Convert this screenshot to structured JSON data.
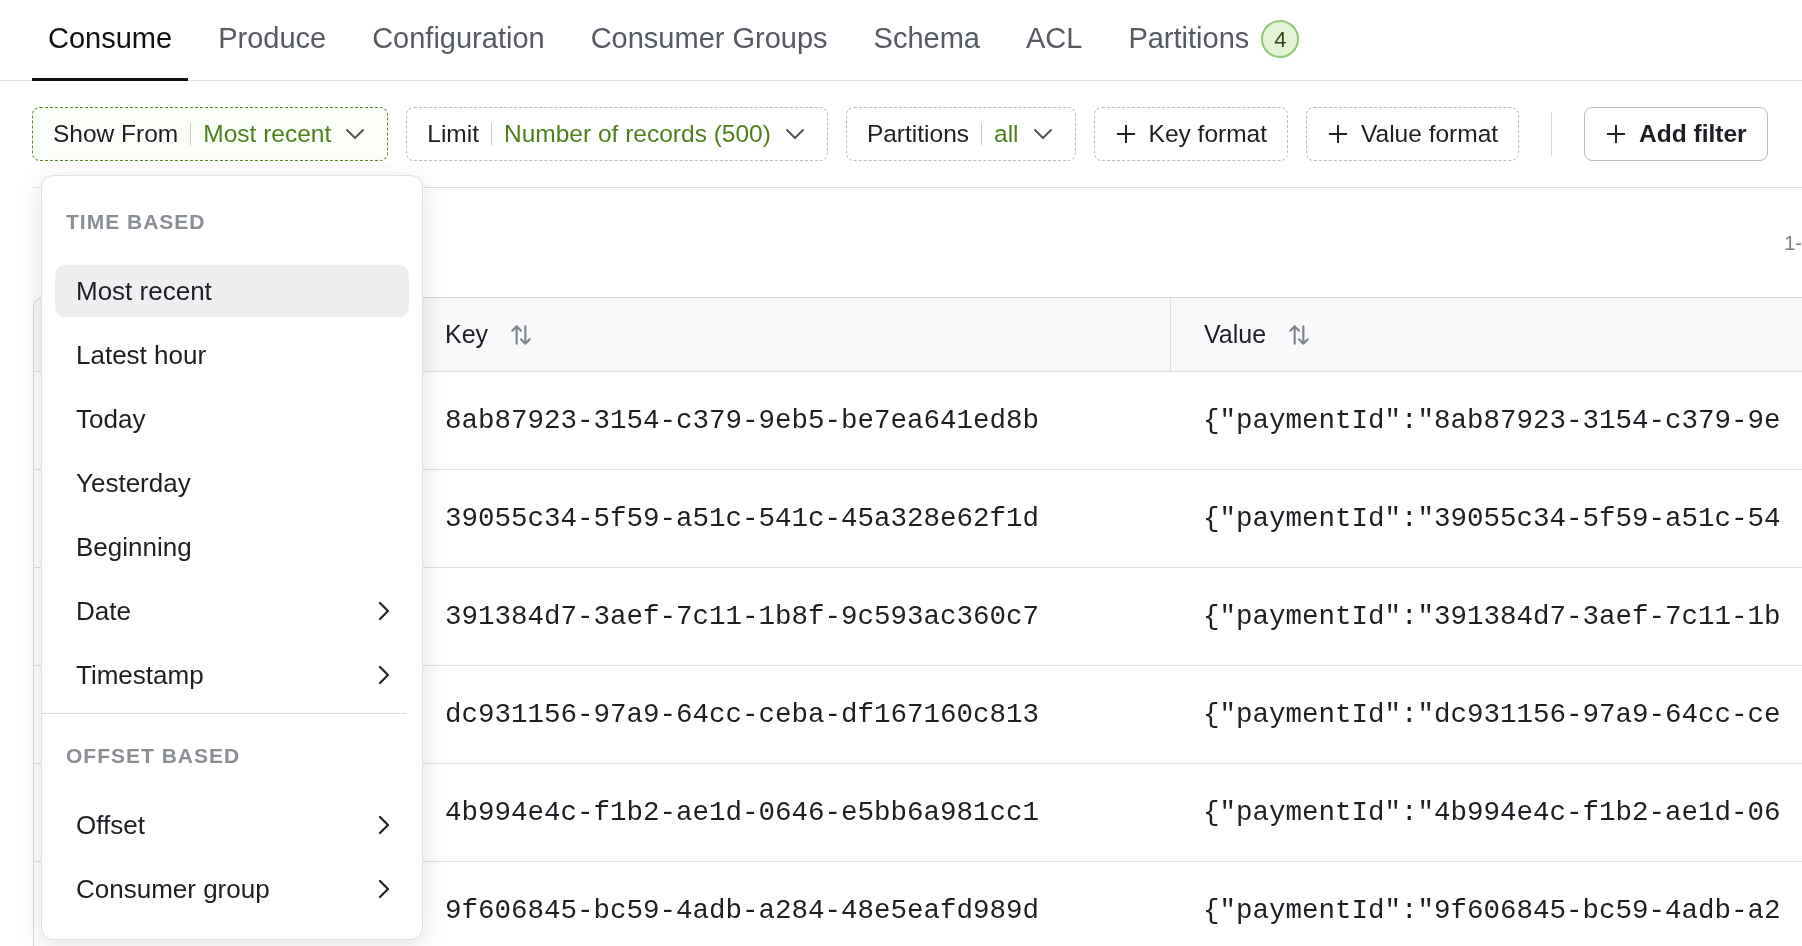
{
  "tabs": [
    {
      "label": "Consume",
      "selected": true
    },
    {
      "label": "Produce",
      "selected": false
    },
    {
      "label": "Configuration",
      "selected": false
    },
    {
      "label": "Consumer Groups",
      "selected": false
    },
    {
      "label": "Schema",
      "selected": false
    },
    {
      "label": "ACL",
      "selected": false
    },
    {
      "label": "Partitions",
      "selected": false,
      "badge": "4"
    }
  ],
  "toolbar": {
    "filters": [
      {
        "kind": "select",
        "label": "Show From",
        "value": "Most recent",
        "open": true
      },
      {
        "kind": "select",
        "label": "Limit",
        "value": "Number of records (500)",
        "open": false
      },
      {
        "kind": "select",
        "label": "Partitions",
        "value": "all",
        "open": false
      },
      {
        "kind": "format",
        "label": "Key format"
      },
      {
        "kind": "format",
        "label": "Value format"
      }
    ],
    "add_filter": "Add filter"
  },
  "pagination": "1-",
  "table": {
    "columns": [
      {
        "label": "Key",
        "sortable": true
      },
      {
        "label": "Value",
        "sortable": true
      }
    ],
    "rows": [
      {
        "key": "8ab87923-3154-c379-9eb5-be7ea641ed8b",
        "value": "{\"paymentId\":\"8ab87923-3154-c379-9e"
      },
      {
        "key": "39055c34-5f59-a51c-541c-45a328e62f1d",
        "value": "{\"paymentId\":\"39055c34-5f59-a51c-54"
      },
      {
        "key": "391384d7-3aef-7c11-1b8f-9c593ac360c7",
        "value": "{\"paymentId\":\"391384d7-3aef-7c11-1b"
      },
      {
        "key": "dc931156-97a9-64cc-ceba-df167160c813",
        "value": "{\"paymentId\":\"dc931156-97a9-64cc-ce"
      },
      {
        "key": "4b994e4c-f1b2-ae1d-0646-e5bb6a981cc1",
        "value": "{\"paymentId\":\"4b994e4c-f1b2-ae1d-06"
      },
      {
        "key": "9f606845-bc59-4adb-a284-48e5eafd989d",
        "value": "{\"paymentId\":\"9f606845-bc59-4adb-a2"
      }
    ]
  },
  "dropdown": {
    "sections": [
      {
        "title": "TIME BASED",
        "items": [
          {
            "label": "Most recent",
            "selected": true,
            "submenu": false
          },
          {
            "label": "Latest hour",
            "selected": false,
            "submenu": false
          },
          {
            "label": "Today",
            "selected": false,
            "submenu": false
          },
          {
            "label": "Yesterday",
            "selected": false,
            "submenu": false
          },
          {
            "label": "Beginning",
            "selected": false,
            "submenu": false
          },
          {
            "label": "Date",
            "selected": false,
            "submenu": true
          },
          {
            "label": "Timestamp",
            "selected": false,
            "submenu": true
          }
        ]
      },
      {
        "title": "OFFSET BASED",
        "items": [
          {
            "label": "Offset",
            "selected": false,
            "submenu": true
          },
          {
            "label": "Consumer group",
            "selected": false,
            "submenu": true
          }
        ]
      }
    ]
  }
}
